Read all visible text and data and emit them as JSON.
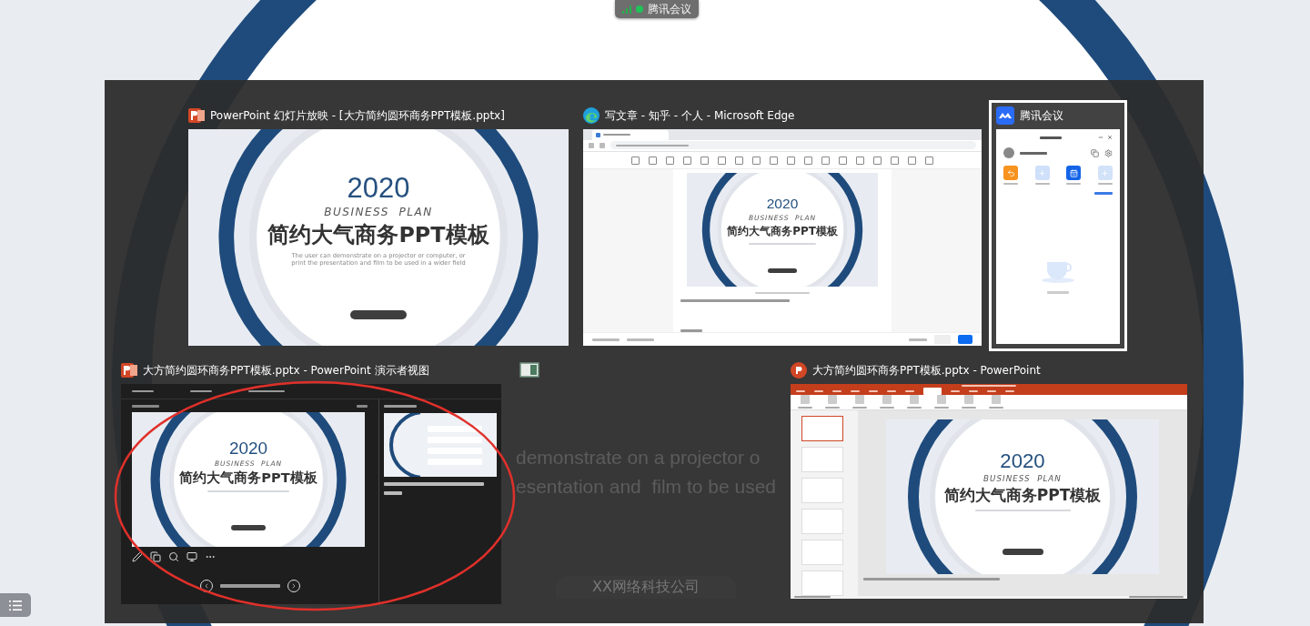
{
  "top_indicator": {
    "label": "腾讯会议"
  },
  "rows": [
    {
      "windows": [
        {
          "kind": "slideshow",
          "title": "PowerPoint 幻灯片放映 - [大方简约圆环商务PPT模板.pptx]",
          "selected": false,
          "slide": {
            "year": "2020",
            "tagline": "BUSINESS  PLAN",
            "title": "简约大气商务PPT模板",
            "subtitle": "The user can demonstrate on a projector or computer, or print the presentation and  film to be used in a wider field"
          }
        },
        {
          "kind": "browser",
          "title": "写文章 - 知乎 - 个人 - Microsoft Edge",
          "selected": false,
          "slide": {
            "year": "2020",
            "tagline": "BUSINESS  PLAN",
            "title": "简约大气商务PPT模板"
          }
        },
        {
          "kind": "meeting",
          "title": "腾讯会议",
          "selected": true
        }
      ]
    },
    {
      "windows": [
        {
          "kind": "presenter",
          "title": "大方简约圆环商务PPT模板.pptx - PowerPoint 演示者视图",
          "selected": false,
          "slide": {
            "year": "2020",
            "tagline": "BUSINESS  PLAN",
            "title": "简约大气商务PPT模板"
          }
        },
        {
          "kind": "blank",
          "selected": false
        },
        {
          "kind": "editor",
          "title": "大方简约圆环商务PPT模板.pptx - PowerPoint",
          "selected": false,
          "slide": {
            "year": "2020",
            "tagline": "BUSINESS  PLAN",
            "title": "简约大气商务PPT模板"
          }
        }
      ]
    }
  ],
  "background_slide": {
    "fragments": [
      "demonstrate on a projector o",
      "esentation and  film to be used"
    ],
    "company": "XX网络科技公司"
  }
}
